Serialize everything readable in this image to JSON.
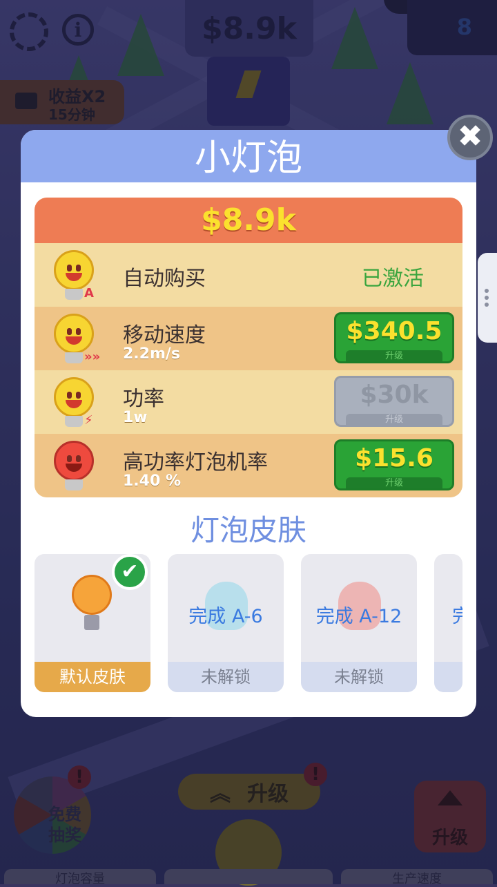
{
  "hud": {
    "money": "$8.9k",
    "gems": "8",
    "income_boost": "收益X2",
    "income_duration": "15分钟",
    "info_glyph": "i",
    "lottery_label_1": "免费",
    "lottery_label_2": "抽奖",
    "upgrade_center_label": "升级",
    "upgrade_right_label": "升级",
    "alert_glyph": "!",
    "bottom_tab_1": "灯泡容量",
    "bottom_tab_3": "生产速度"
  },
  "modal": {
    "title": "小灯泡",
    "close_glyph": "✖",
    "price": "$8.9k",
    "rows": [
      {
        "name": "自动购买",
        "badge": "A",
        "status": "已激活"
      },
      {
        "name": "移动速度",
        "sub": "2.2m/s",
        "badge": "»»",
        "button_value": "$340.5",
        "button_label": "升级",
        "enabled": true
      },
      {
        "name": "功率",
        "sub": "1w",
        "badge": "⚡",
        "button_value": "$30k",
        "button_label": "升级",
        "enabled": false
      },
      {
        "name": "高功率灯泡机率",
        "sub": "1.40 %",
        "button_value": "$15.6",
        "button_label": "升级",
        "enabled": true
      }
    ],
    "skins_title": "灯泡皮肤",
    "skins": [
      {
        "footer": "默认皮肤",
        "selected": true,
        "check_glyph": "✔"
      },
      {
        "footer": "未解锁",
        "condition": "完成 A-6"
      },
      {
        "footer": "未解锁",
        "condition": "完成 A-12"
      },
      {
        "footer": "",
        "condition": "完"
      }
    ]
  },
  "colors": {
    "header": "#8ea8ee",
    "price_bar": "#ee7c54",
    "price_text": "#fbe12e",
    "button_green": "#2aa336",
    "button_disabled": "#a9b0bd",
    "status_active": "#3aa53e",
    "skin_selected": "#e6a94a",
    "skins_title": "#6f8fe0"
  }
}
